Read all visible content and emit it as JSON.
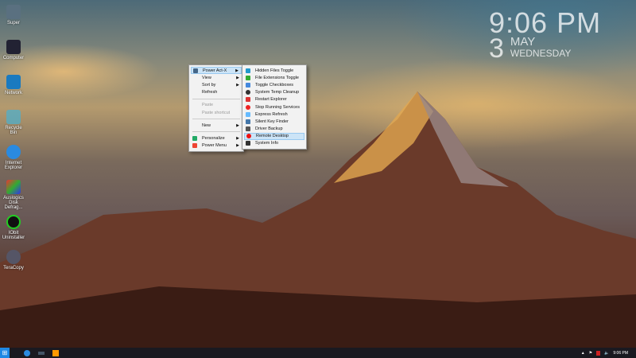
{
  "desktop_icons": [
    {
      "label": "Super"
    },
    {
      "label": "Computer"
    },
    {
      "label": "Network"
    },
    {
      "label": "Recycle Bin"
    },
    {
      "label": "Internet Explorer"
    },
    {
      "label": "Auslogics Disk Defrag..."
    },
    {
      "label": "IObit Uninstaller"
    },
    {
      "label": "TeraCopy"
    }
  ],
  "clock": {
    "time": "9:06 PM",
    "day": "3",
    "month": "MAY",
    "weekday": "WEDNESDAY"
  },
  "context_menu": {
    "items": [
      "Power Act-X",
      "View",
      "Sort by",
      "Refresh",
      "Paste",
      "Paste shortcut",
      "New",
      "Personalize",
      "Power Menu"
    ]
  },
  "submenu": {
    "items": [
      "Hidden Files Toggle",
      "File Extensions Toggle",
      "Toggle Checkboxes",
      "System Temp Cleanup",
      "Restart Explorer",
      "Stop Running Services",
      "Express Refresh",
      "Silent Key Finder",
      "Driver Backup",
      "Remote Desktop",
      "System Info"
    ],
    "highlighted": "Remote Desktop"
  },
  "taskbar": {
    "time": "9:06 PM"
  }
}
